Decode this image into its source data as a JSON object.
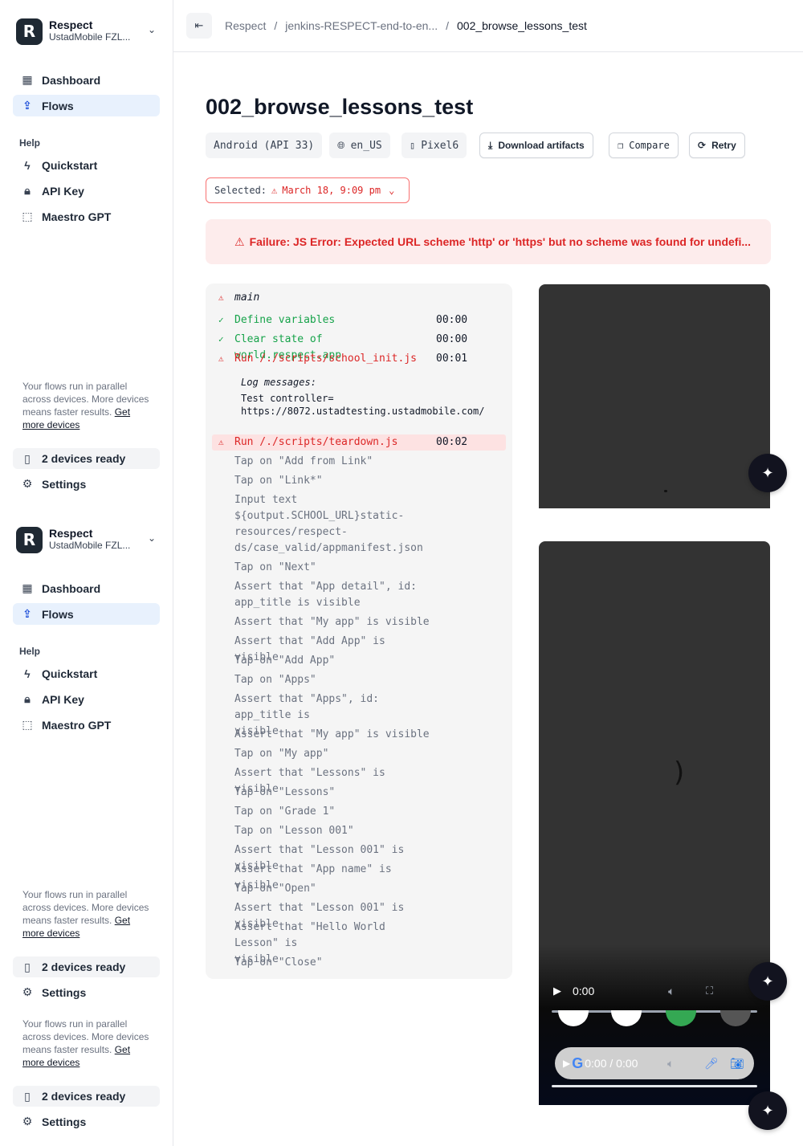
{
  "sidebar_blocks": [
    {
      "org": {
        "name": "Respect",
        "sub": "UstadMobile FZL..."
      },
      "nav": [
        {
          "label": "Dashboard"
        },
        {
          "label": "Flows"
        }
      ],
      "help_label": "Help",
      "help_items": [
        {
          "label": "Quickstart"
        },
        {
          "label": "API Key"
        },
        {
          "label": "Maestro GPT"
        }
      ],
      "promo": {
        "text": "Your flows run in parallel across devices. More devices means faster results. ",
        "link": "Get more devices"
      },
      "devices": "2 devices ready",
      "settings": "Settings"
    },
    {
      "org": {
        "name": "Respect",
        "sub": "UstadMobile FZL..."
      },
      "nav": [
        {
          "label": "Dashboard"
        },
        {
          "label": "Flows"
        }
      ],
      "help_label": "Help",
      "help_items": [
        {
          "label": "Quickstart"
        },
        {
          "label": "API Key"
        },
        {
          "label": "Maestro GPT"
        }
      ],
      "promo": {
        "text": "Your flows run in parallel across devices. More devices means faster results. ",
        "link": "Get more devices"
      },
      "devices": "2 devices ready",
      "settings": "Settings"
    }
  ],
  "sidebar_extra": {
    "promo": {
      "text": "Your flows run in parallel across devices. More devices means faster results. ",
      "link": "Get more devices"
    },
    "devices": "2 devices ready",
    "settings": "Settings"
  },
  "breadcrumb": {
    "items": [
      "Respect",
      "jenkins-RESPECT-end-to-en...",
      "002_browse_lessons_test"
    ],
    "separator": "/"
  },
  "page": {
    "title": "002_browse_lessons_test",
    "chips": [
      "Android (API 33)",
      "en_US",
      "Pixel6"
    ],
    "buttons": {
      "download": "Download artifacts",
      "compare": "Compare",
      "retry": "Retry"
    },
    "selected_label": "Selected:",
    "selected_value": "March 18, 9:09 pm",
    "failure": "Failure: JS Error: Expected URL scheme 'http' or 'https' but no scheme was found for undefi..."
  },
  "steps": {
    "head": "main",
    "items": [
      {
        "status": "ok",
        "label": "Define variables",
        "time": "00:00"
      },
      {
        "status": "ok",
        "label": "Clear state of world.respect.app",
        "time": "00:00"
      },
      {
        "status": "fail",
        "label": "Run /./scripts/school_init.js",
        "time": "00:01"
      },
      {
        "status": "fail",
        "label": "Run /./scripts/teardown.js",
        "time": "00:02"
      },
      {
        "status": "pending",
        "label": "Tap on \"Add from Link\""
      },
      {
        "status": "pending",
        "label": "Tap on \"Link*\""
      },
      {
        "status": "pending",
        "label": "Input text\n${output.SCHOOL_URL}static-\nresources/respect-\nds/case_valid/appmanifest.json"
      },
      {
        "status": "pending",
        "label": "Tap on \"Next\""
      },
      {
        "status": "pending",
        "label": "Assert that \"App detail\", id:\napp_title is visible"
      },
      {
        "status": "pending",
        "label": "Assert that \"My app\" is visible"
      },
      {
        "status": "pending",
        "label": "Assert that \"Add App\" is visible"
      },
      {
        "status": "pending",
        "label": "Tap on \"Add App\""
      },
      {
        "status": "pending",
        "label": "Tap on \"Apps\""
      },
      {
        "status": "pending",
        "label": "Assert that \"Apps\", id: app_title is\nvisible"
      },
      {
        "status": "pending",
        "label": "Assert that \"My app\" is visible"
      },
      {
        "status": "pending",
        "label": "Tap on \"My app\""
      },
      {
        "status": "pending",
        "label": "Assert that \"Lessons\" is visible"
      },
      {
        "status": "pending",
        "label": "Tap on \"Lessons\""
      },
      {
        "status": "pending",
        "label": "Tap on \"Grade 1\""
      },
      {
        "status": "pending",
        "label": "Tap on \"Lesson 001\""
      },
      {
        "status": "pending",
        "label": "Assert that \"Lesson 001\" is visible"
      },
      {
        "status": "pending",
        "label": "Assert that \"App name\" is visible"
      },
      {
        "status": "pending",
        "label": "Tap on \"Open\""
      },
      {
        "status": "pending",
        "label": "Assert that \"Lesson 001\" is visible"
      },
      {
        "status": "pending",
        "label": "Assert that \"Hello World Lesson\" is\nvisible"
      },
      {
        "status": "pending",
        "label": "Tap on \"Close\""
      }
    ],
    "log_title": "Log messages:",
    "log_text": "Test controller=\nhttps://8072.ustadtesting.ustadmobile.com/"
  },
  "video": {
    "time": "0:00",
    "time_full": "0:00 / 0:00",
    "search_logo": "G"
  },
  "colors": {
    "accent": "#1d4ed8",
    "error": "#dc2626",
    "success": "#16a34a",
    "active_nav_bg": "#e8f1fd"
  }
}
